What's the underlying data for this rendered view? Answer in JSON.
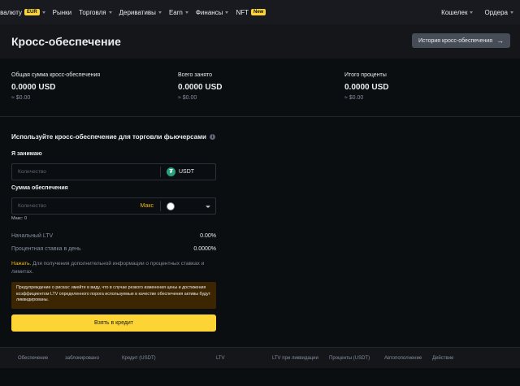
{
  "nav": {
    "items": [
      {
        "label": "пить криптовалюту",
        "visible_label": "пить криптовалюту"
      },
      {
        "label": "Рынки"
      },
      {
        "label": "Торговля"
      },
      {
        "label": "Деривативы"
      },
      {
        "label": "Earn"
      },
      {
        "label": "Финансы"
      },
      {
        "label": "NFT"
      }
    ],
    "first_label": "пить криптовалюту",
    "first_badge": "EUR",
    "markets": "Рынки",
    "trade": "Торговля",
    "derivatives": "Деривативы",
    "earn": "Earn",
    "finance": "Финансы",
    "nft": "NFT",
    "nft_badge": "New",
    "wallet": "Кошелек",
    "orders": "Ордера"
  },
  "header": {
    "title": "Кросс-обеспечение",
    "history_button": "История кросс-обеспечения"
  },
  "stats": {
    "total_collateral": {
      "label": "Общая сумма кросс-обеспечения",
      "value": "0.0000 USD",
      "sub": "≈ $0.00"
    },
    "total_borrowed": {
      "label": "Всего занято",
      "value": "0.0000 USD",
      "sub": "≈ $0.00"
    },
    "total_interest": {
      "label": "Итого проценты",
      "value": "0.0000 USD",
      "sub": "≈ $0.00"
    }
  },
  "form": {
    "title": "Используйте кросс-обеспечение для торговли фьючерсами",
    "borrow_label": "Я занимаю",
    "borrow_placeholder": "Количество",
    "borrow_coin": "USDT",
    "collateral_label": "Сумма обеспечения",
    "collateral_placeholder": "Количество",
    "max_link": "Макс",
    "max_note": "Макс: 0",
    "initial_ltv_label": "Начальный LTV",
    "initial_ltv_value": "0.00%",
    "daily_rate_label": "Процентная ставка в день",
    "daily_rate_value": "0.0000%",
    "note_link": "Нажать.",
    "note_text": " Для получения дополнительной информации о процентных ставках и лимитах.",
    "warning": "Предупреждение о рисках: имейте в виду, что в случае резкого изменения цены и достижения коэффициентом LTV определенного порога используемые в качестве обеспечения активы будут ликвидированы.",
    "borrow_button": "Взять в кредит"
  },
  "table": {
    "headers": [
      "Обеспечение",
      "заблокировано",
      "Кредит (USDT)",
      "LTV",
      "LTV при ликвидации",
      "Проценты (USDT)",
      "Автопополнение",
      "Действие"
    ]
  },
  "colors": {
    "accent": "#fcd535",
    "background": "#0b0e11",
    "usdt": "#26a17b",
    "warning_bg": "#3c2601"
  }
}
